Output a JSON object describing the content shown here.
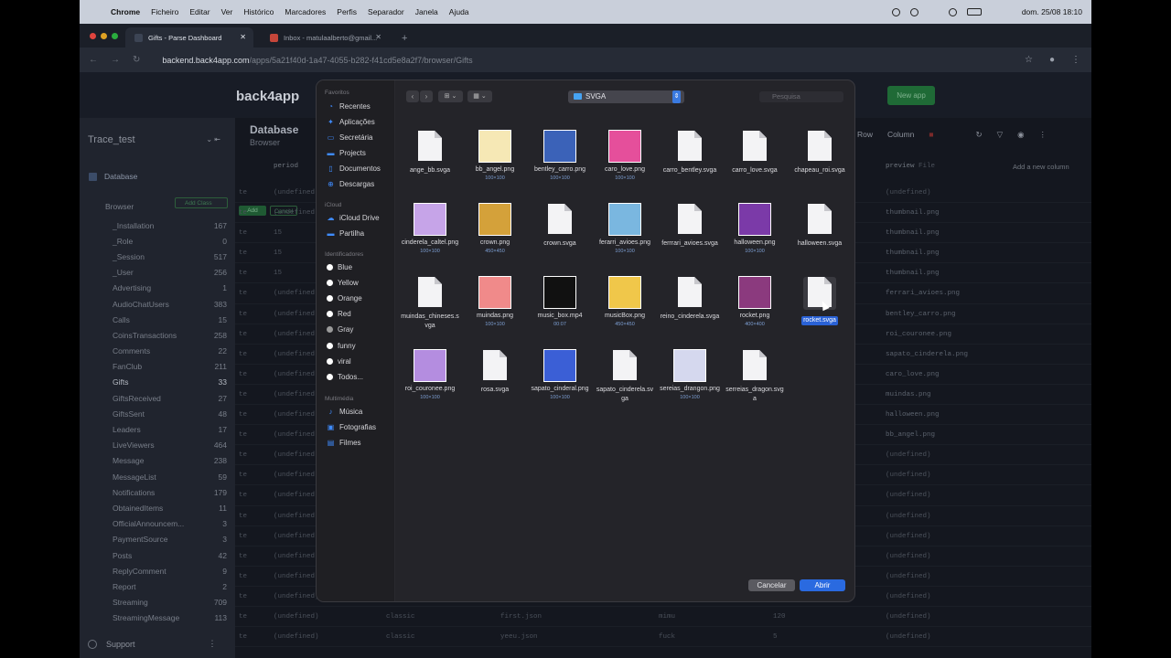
{
  "menubar": {
    "app": "Chrome",
    "items": [
      "Ficheiro",
      "Editar",
      "Ver",
      "Histórico",
      "Marcadores",
      "Perfis",
      "Separador",
      "Janela",
      "Ajuda"
    ],
    "clock": "dom. 25/08  18:10"
  },
  "browser": {
    "tabs": [
      {
        "title": "Gifts - Parse Dashboard",
        "active": true
      },
      {
        "title": "Inbox - matulaalberto@gmail...",
        "active": false
      }
    ],
    "url_host": "backend.back4app.com",
    "url_path": "/apps/5a21f40d-1a47-4055-b282-f41cd5e8a2f7/browser/Gifts"
  },
  "app": {
    "logo": "back4app",
    "new_app": "New app",
    "app_name": "Trace_test",
    "database_label": "Database",
    "browser_label": "Browser",
    "add_class": "Add Class",
    "support": "Support",
    "main_title": "Database",
    "main_sub": "Browser",
    "toolbar": [
      "Row",
      "Column"
    ],
    "col_first": "period",
    "col_preview": "preview",
    "col_preview_type": "File",
    "add_column": "Add a new column",
    "add_row_btns": [
      "Add",
      "Cancel"
    ],
    "classes": [
      {
        "name": "_Installation",
        "count": "167"
      },
      {
        "name": "_Role",
        "count": "0"
      },
      {
        "name": "_Session",
        "count": "517"
      },
      {
        "name": "_User",
        "count": "256"
      },
      {
        "name": "Advertising",
        "count": "1"
      },
      {
        "name": "AudioChatUsers",
        "count": "383"
      },
      {
        "name": "Calls",
        "count": "15"
      },
      {
        "name": "CoinsTransactions",
        "count": "258"
      },
      {
        "name": "Comments",
        "count": "22"
      },
      {
        "name": "FanClub",
        "count": "211"
      },
      {
        "name": "Gifts",
        "count": "33",
        "active": true
      },
      {
        "name": "GiftsReceived",
        "count": "27"
      },
      {
        "name": "GiftsSent",
        "count": "48"
      },
      {
        "name": "Leaders",
        "count": "17"
      },
      {
        "name": "LiveViewers",
        "count": "464"
      },
      {
        "name": "Message",
        "count": "238"
      },
      {
        "name": "MessageList",
        "count": "59"
      },
      {
        "name": "Notifications",
        "count": "179"
      },
      {
        "name": "ObtainedItems",
        "count": "11"
      },
      {
        "name": "OfficialAnnouncem...",
        "count": "3"
      },
      {
        "name": "PaymentSource",
        "count": "3"
      },
      {
        "name": "Posts",
        "count": "42"
      },
      {
        "name": "ReplyComment",
        "count": "9"
      },
      {
        "name": "Report",
        "count": "2"
      },
      {
        "name": "Streaming",
        "count": "709"
      },
      {
        "name": "StreamingMessage",
        "count": "113"
      }
    ],
    "rows": [
      {
        "a": "te",
        "b": "(undefined)",
        "prev": "(undefined)"
      },
      {
        "a": "te",
        "b": "(undefined)",
        "prev": "thumbnail.png"
      },
      {
        "a": "te",
        "b": "15",
        "prev": "thumbnail.png"
      },
      {
        "a": "te",
        "b": "15",
        "prev": "thumbnail.png"
      },
      {
        "a": "te",
        "b": "15",
        "prev": "thumbnail.png"
      },
      {
        "a": "te",
        "b": "(undefined)",
        "prev": "ferrari_avioes.png"
      },
      {
        "a": "te",
        "b": "(undefined)",
        "prev": "bentley_carro.png"
      },
      {
        "a": "te",
        "b": "(undefined)",
        "prev": "roi_couronee.png"
      },
      {
        "a": "te",
        "b": "(undefined)",
        "prev": "sapato_cinderela.png"
      },
      {
        "a": "te",
        "b": "(undefined)",
        "prev": "caro_love.png"
      },
      {
        "a": "te",
        "b": "(undefined)",
        "prev": "muindas.png"
      },
      {
        "a": "te",
        "b": "(undefined)",
        "prev": "halloween.png"
      },
      {
        "a": "te",
        "b": "(undefined)",
        "prev": "bb_angel.png"
      },
      {
        "a": "te",
        "b": "(undefined)",
        "prev": "(undefined)"
      },
      {
        "a": "te",
        "b": "(undefined)",
        "prev": "(undefined)"
      },
      {
        "a": "te",
        "b": "(undefined)",
        "prev": "(undefined)"
      },
      {
        "a": "te",
        "b": "(undefined)",
        "prev": "(undefined)"
      },
      {
        "a": "te",
        "b": "(undefined)",
        "prev": "(undefined)"
      },
      {
        "a": "te",
        "b": "(undefined)",
        "prev": "(undefined)"
      },
      {
        "a": "te",
        "b": "(undefined)",
        "prev": "(undefined)"
      },
      {
        "a": "te",
        "b": "(undefined)",
        "prev": "(undefined)"
      },
      {
        "a": "te",
        "b": "(undefined)",
        "c": "classic",
        "d": "first.json",
        "e": "mimu",
        "f": "120",
        "prev": "(undefined)"
      },
      {
        "a": "te",
        "b": "(undefined)",
        "c": "classic",
        "d": "yeeu.json",
        "e": "fuck",
        "f": "5",
        "prev": "(undefined)"
      }
    ]
  },
  "dialog": {
    "favorites_header": "Favoritos",
    "favorites": [
      "Recentes",
      "Aplicações",
      "Secretária",
      "Projects",
      "Documentos",
      "Descargas"
    ],
    "icloud_header": "iCloud",
    "icloud": [
      "iCloud Drive",
      "Partilha"
    ],
    "tags_header": "Identificadores",
    "tags": [
      {
        "name": "Blue",
        "color": "#ffffff"
      },
      {
        "name": "Yellow",
        "color": "#ffffff"
      },
      {
        "name": "Orange",
        "color": "#ffffff"
      },
      {
        "name": "Red",
        "color": "#ffffff"
      },
      {
        "name": "Gray",
        "color": "#9a9a9a"
      },
      {
        "name": "funny",
        "color": "#ffffff"
      },
      {
        "name": "viral",
        "color": "#ffffff"
      },
      {
        "name": "Todos...",
        "color": "#ffffff"
      }
    ],
    "media_header": "Multimédia",
    "media": [
      "Música",
      "Fotografias",
      "Filmes"
    ],
    "folder": "SVGA",
    "search_placeholder": "Pesquisa",
    "cancel": "Cancelar",
    "open": "Abrir",
    "files": [
      {
        "name": "ange_bb.svga",
        "type": "doc",
        "sub": ""
      },
      {
        "name": "bb_angel.png",
        "type": "img",
        "sub": "100×100",
        "color": "#f6e8b5"
      },
      {
        "name": "bentley_carro.png",
        "type": "img",
        "sub": "100×100",
        "color": "#3b62b8"
      },
      {
        "name": "caro_love.png",
        "type": "img",
        "sub": "100×100",
        "color": "#e54f9b"
      },
      {
        "name": "carro_bentley.svga",
        "type": "doc",
        "sub": ""
      },
      {
        "name": "carro_love.svga",
        "type": "doc",
        "sub": ""
      },
      {
        "name": "chapeau_roi.svga",
        "type": "doc",
        "sub": ""
      },
      {
        "name": "cinderela_caltel.png",
        "type": "img",
        "sub": "100×100",
        "color": "#c6a4e8"
      },
      {
        "name": "crown.png",
        "type": "img",
        "sub": "450×450",
        "color": "#d4a13a"
      },
      {
        "name": "crown.svga",
        "type": "doc",
        "sub": ""
      },
      {
        "name": "ferarri_avioes.png",
        "type": "img",
        "sub": "100×100",
        "color": "#7ab7e0"
      },
      {
        "name": "ferrrari_avioes.svga",
        "type": "doc",
        "sub": ""
      },
      {
        "name": "halloween.png",
        "type": "img",
        "sub": "100×100",
        "color": "#7b3aa8"
      },
      {
        "name": "halloween.svga",
        "type": "doc",
        "sub": ""
      },
      {
        "name": "muindas_chineses.svga",
        "type": "doc",
        "sub": ""
      },
      {
        "name": "muindas.png",
        "type": "img",
        "sub": "100×100",
        "color": "#f08a8a"
      },
      {
        "name": "music_box.mp4",
        "type": "img",
        "sub": "00:07",
        "color": "#111111"
      },
      {
        "name": "musicBox.png",
        "type": "img",
        "sub": "450×450",
        "color": "#f0c74a"
      },
      {
        "name": "reino_cinderela.svga",
        "type": "doc",
        "sub": ""
      },
      {
        "name": "rocket.png",
        "type": "img",
        "sub": "400×400",
        "color": "#8b3a7e"
      },
      {
        "name": "rocket.svga",
        "type": "doc",
        "sub": "",
        "selected": true
      },
      {
        "name": "roi_couronee.png",
        "type": "img",
        "sub": "100×100",
        "color": "#b48de0"
      },
      {
        "name": "rosa.svga",
        "type": "doc",
        "sub": ""
      },
      {
        "name": "sapato_cinderal.png",
        "type": "img",
        "sub": "100×100",
        "color": "#3b5fd6"
      },
      {
        "name": "sapato_cinderela.svga",
        "type": "doc",
        "sub": ""
      },
      {
        "name": "sereias_drangon.png",
        "type": "img",
        "sub": "100×100",
        "color": "#d5d8ee"
      },
      {
        "name": "serreias_dragon.svga",
        "type": "doc",
        "sub": ""
      }
    ]
  }
}
